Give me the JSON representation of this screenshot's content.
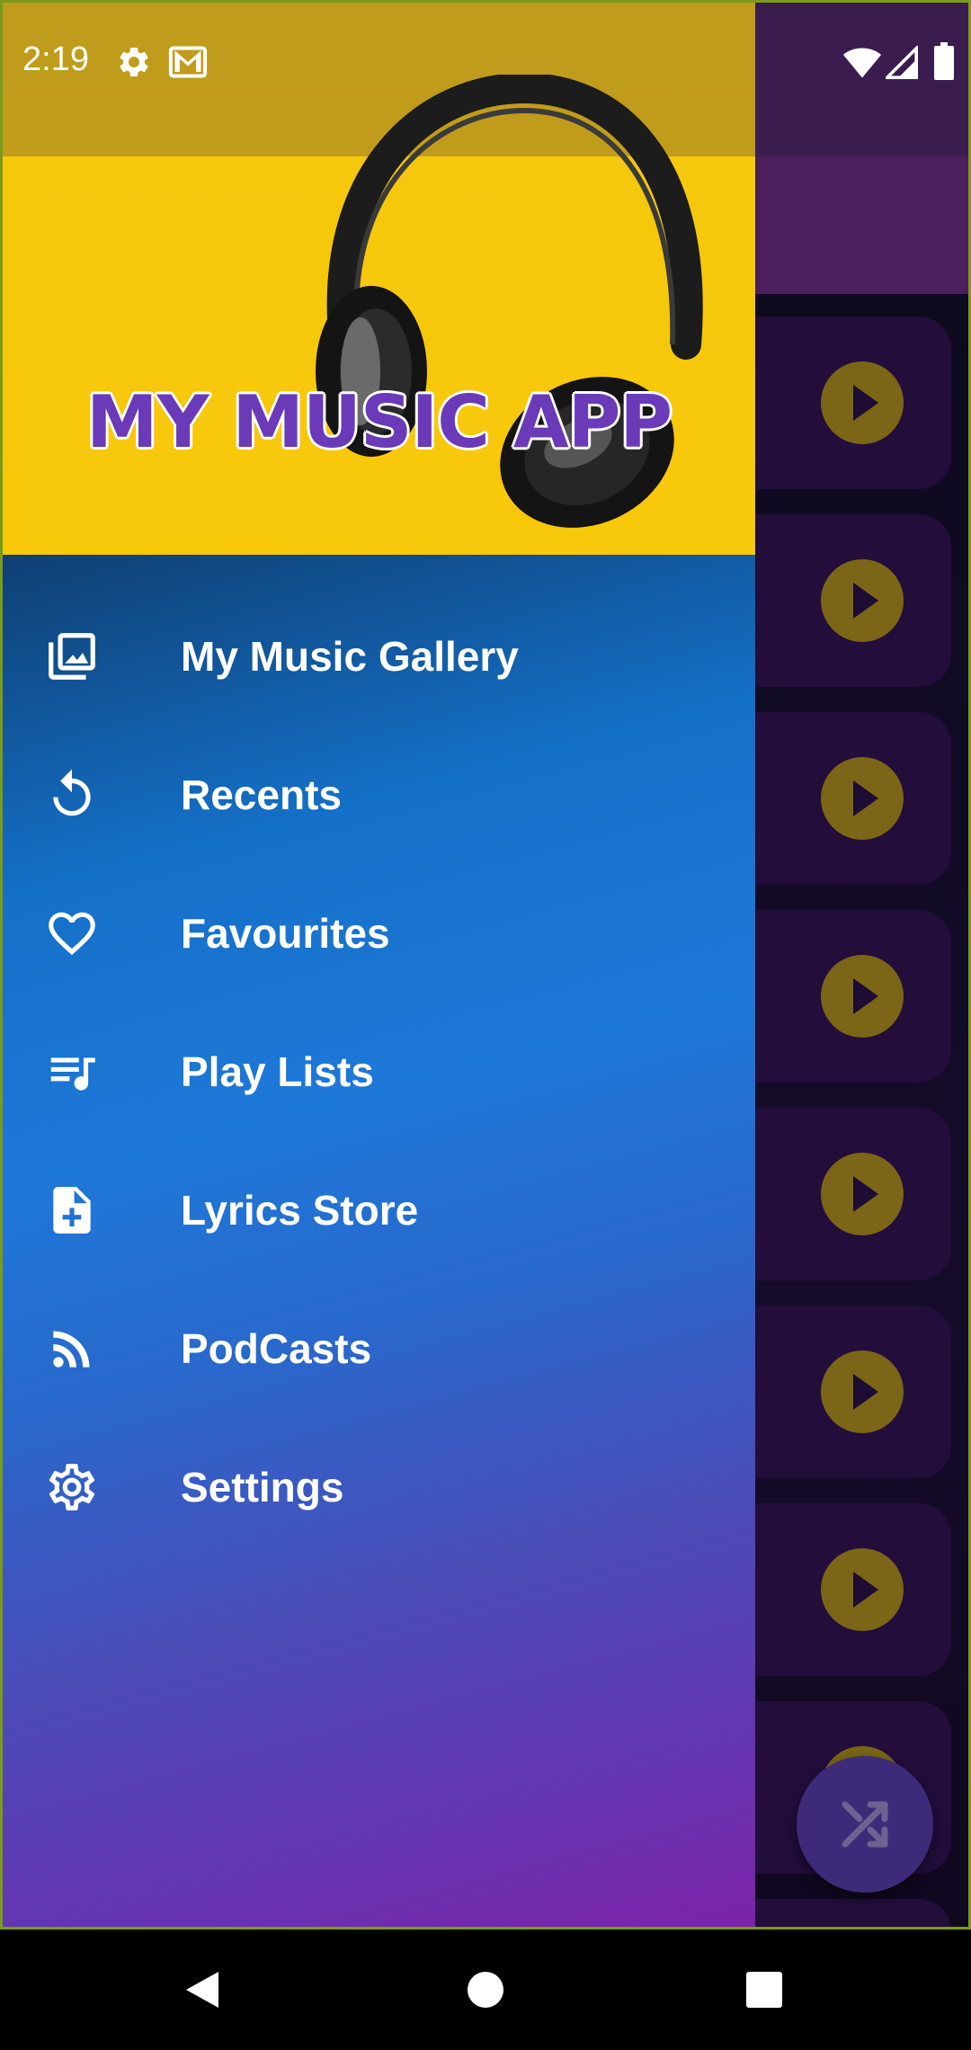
{
  "status_bar": {
    "time": "2:19",
    "icons": [
      "gear-icon",
      "mail-icon",
      "wifi-icon",
      "signal-icon",
      "battery-icon"
    ]
  },
  "drawer": {
    "header": {
      "title": "MY MUSIC APP",
      "image": "headphones-on-yellow"
    },
    "menu": [
      {
        "label": "My Music Gallery",
        "icon": "gallery-icon"
      },
      {
        "label": "Recents",
        "icon": "history-icon"
      },
      {
        "label": "Favourites",
        "icon": "heart-icon"
      },
      {
        "label": "Play Lists",
        "icon": "playlist-icon"
      },
      {
        "label": "Lyrics Store",
        "icon": "note-add-icon"
      },
      {
        "label": "PodCasts",
        "icon": "rss-icon"
      },
      {
        "label": "Settings",
        "icon": "settings-icon"
      }
    ]
  },
  "background_app": {
    "fab_icon": "shuffle-icon",
    "song_play_icon": "play-icon"
  },
  "nav_bar": {
    "buttons": [
      "back-icon",
      "home-icon",
      "recents-icon"
    ]
  },
  "colors": {
    "title": "#6a3ab8",
    "header_bg": "#f4c80e",
    "drawer_gradient_top": "#0f3f72",
    "drawer_gradient_mid": "#1e78d8",
    "drawer_gradient_bottom": "#7d22a8",
    "play_button": "#7b6516",
    "fab": "#3d2b7a"
  }
}
